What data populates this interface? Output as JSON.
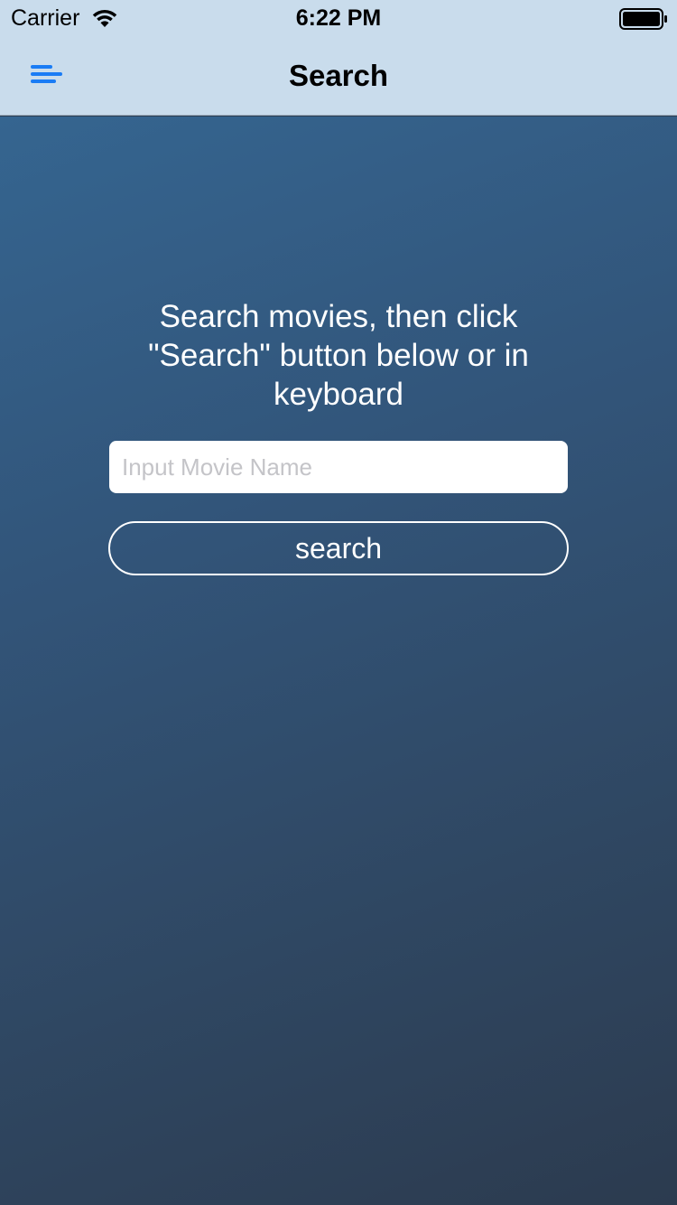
{
  "status_bar": {
    "carrier": "Carrier",
    "time": "6:22 PM",
    "wifi_icon": "wifi-icon",
    "battery_icon": "battery-icon"
  },
  "nav_bar": {
    "menu_icon": "menu-icon",
    "title": "Search",
    "accent_color": "#1a7cf5",
    "background_color": "#c9dcec"
  },
  "main": {
    "instructions": "Search movies, then click \"Search\" button below or in keyboard",
    "search_input": {
      "placeholder": "Input Movie Name",
      "value": ""
    },
    "search_button_label": "search",
    "gradient_top_color": "#356590",
    "gradient_bottom_color": "#2c3b4f"
  }
}
